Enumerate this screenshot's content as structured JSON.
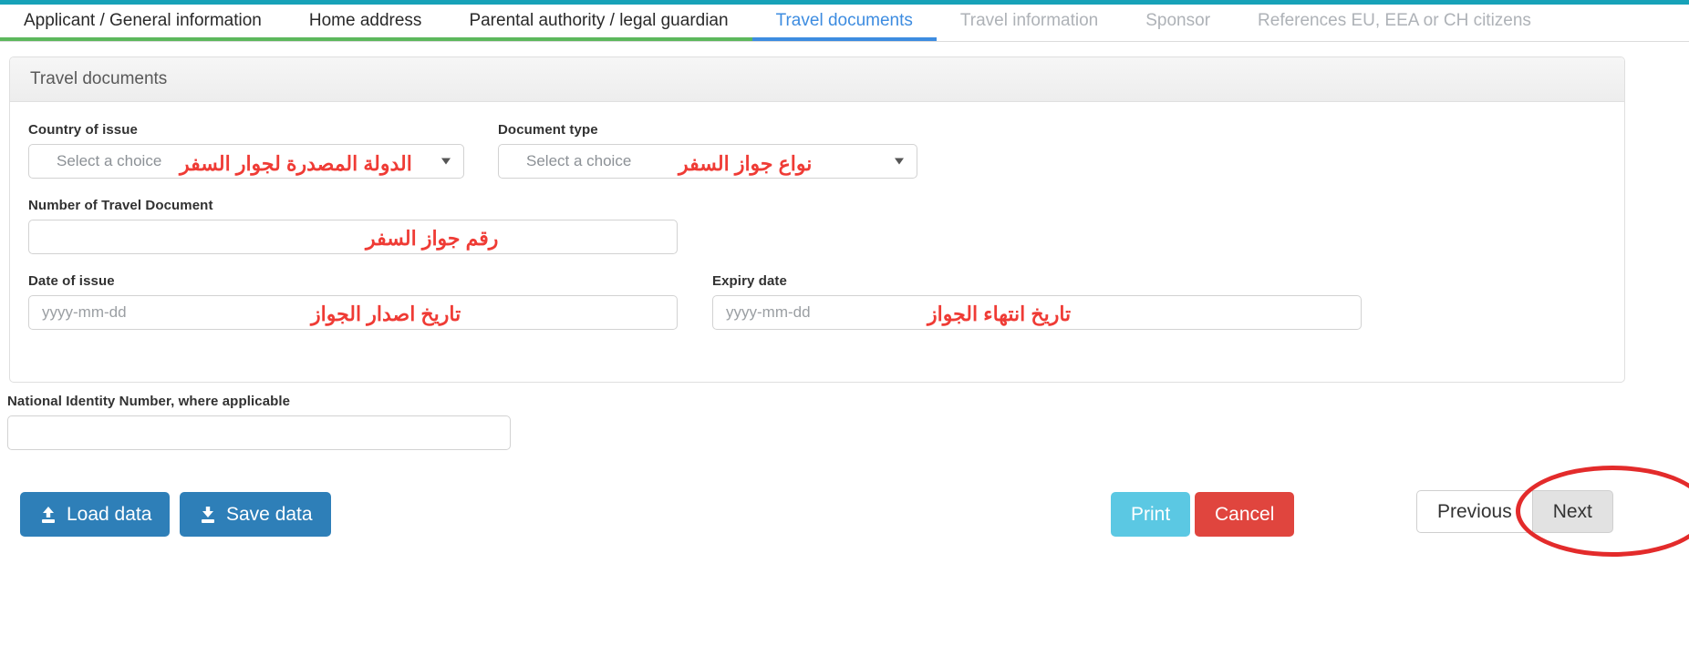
{
  "theme": {
    "accent_teal": "#17a2b8",
    "tab_active": "#3d8ce0",
    "tab_done": "#5cb85c",
    "annotation_red": "#ef3b35",
    "button_blue": "#2e7fb8",
    "button_print": "#5bc8e3",
    "button_cancel": "#e0453e",
    "highlight_ellipse": "#e32b2b"
  },
  "tabs": [
    {
      "label": "Applicant / General information",
      "state": "done"
    },
    {
      "label": "Home address",
      "state": "done"
    },
    {
      "label": "Parental authority / legal guardian",
      "state": "done"
    },
    {
      "label": "Travel documents",
      "state": "active"
    },
    {
      "label": "Travel information",
      "state": "disabled"
    },
    {
      "label": "Sponsor",
      "state": "disabled"
    },
    {
      "label": "References EU, EEA or CH citizens",
      "state": "disabled"
    }
  ],
  "panel": {
    "title": "Travel documents",
    "fields": {
      "country_of_issue": {
        "label": "Country of issue",
        "placeholder": "Select a choice",
        "value": "",
        "annotation": "الدولة المصدرة لجوار السفر"
      },
      "document_type": {
        "label": "Document type",
        "placeholder": "Select a choice",
        "value": "",
        "annotation": "نواع جواز السفر"
      },
      "number_of_travel_document": {
        "label": "Number of Travel Document",
        "placeholder": "",
        "value": "",
        "annotation": "رقم جواز السفر"
      },
      "date_of_issue": {
        "label": "Date of issue",
        "placeholder": "yyyy-mm-dd",
        "value": "",
        "annotation": "تاريخ اصدار الجواز"
      },
      "expiry_date": {
        "label": "Expiry date",
        "placeholder": "yyyy-mm-dd",
        "value": "",
        "annotation": "تاريخ انتهاء الجواز"
      }
    }
  },
  "national_identity": {
    "label": "National Identity Number, where applicable",
    "placeholder": "",
    "value": ""
  },
  "actions": {
    "load_data": "Load data",
    "save_data": "Save data",
    "print": "Print",
    "cancel": "Cancel",
    "previous": "Previous",
    "next": "Next"
  },
  "icons": {
    "load": "upload-icon",
    "save": "download-icon",
    "dropdown": "chevron-down-icon",
    "highlight": "ellipse-highlight"
  }
}
